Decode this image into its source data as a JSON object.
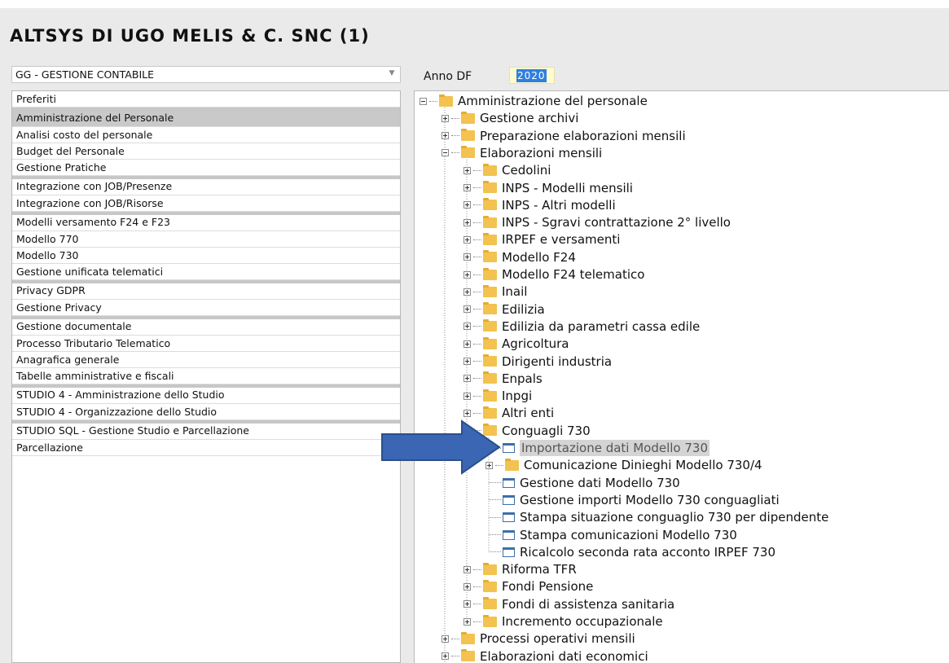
{
  "app_title": "ALTSYS DI UGO MELIS & C. SNC (1)",
  "module_select": {
    "value": "GG - GESTIONE CONTABILE",
    "arrow": "▼"
  },
  "anno": {
    "label": "Anno DF",
    "value": "2020"
  },
  "left_menu": [
    {
      "label": "Preferiti",
      "sep": false,
      "selected": false
    },
    {
      "label": "Amministrazione del Personale",
      "sep": true,
      "selected": true
    },
    {
      "label": "Analisi costo del personale",
      "sep": false,
      "selected": false
    },
    {
      "label": "Budget del Personale",
      "sep": false,
      "selected": false
    },
    {
      "label": "Gestione Pratiche",
      "sep": false,
      "selected": false
    },
    {
      "label": "Integrazione con JOB/Presenze",
      "sep": true,
      "selected": false
    },
    {
      "label": "Integrazione con JOB/Risorse",
      "sep": false,
      "selected": false
    },
    {
      "label": "Modelli versamento F24 e F23",
      "sep": true,
      "selected": false
    },
    {
      "label": "Modello 770",
      "sep": false,
      "selected": false
    },
    {
      "label": "Modello 730",
      "sep": false,
      "selected": false
    },
    {
      "label": "Gestione unificata telematici",
      "sep": false,
      "selected": false
    },
    {
      "label": "Privacy GDPR",
      "sep": true,
      "selected": false
    },
    {
      "label": "Gestione Privacy",
      "sep": false,
      "selected": false
    },
    {
      "label": "Gestione documentale",
      "sep": true,
      "selected": false
    },
    {
      "label": "Processo Tributario Telematico",
      "sep": false,
      "selected": false
    },
    {
      "label": "Anagrafica generale",
      "sep": false,
      "selected": false
    },
    {
      "label": "Tabelle amministrative e fiscali",
      "sep": false,
      "selected": false
    },
    {
      "label": "STUDIO 4 - Amministrazione dello Studio",
      "sep": true,
      "selected": false
    },
    {
      "label": "STUDIO 4 - Organizzazione dello Studio",
      "sep": false,
      "selected": false
    },
    {
      "label": "STUDIO SQL - Gestione Studio e Parcellazione",
      "sep": true,
      "selected": false
    },
    {
      "label": "Parcellazione",
      "sep": false,
      "selected": false
    }
  ],
  "tree": [
    {
      "label": "Amministrazione del personale",
      "depth": 0,
      "icon": "folder-icon",
      "expander": "minus"
    },
    {
      "label": "Gestione archivi",
      "depth": 1,
      "icon": "folder-icon",
      "expander": "plus"
    },
    {
      "label": "Preparazione elaborazioni mensili",
      "depth": 1,
      "icon": "folder-icon",
      "expander": "plus"
    },
    {
      "label": "Elaborazioni mensili",
      "depth": 1,
      "icon": "folder-icon",
      "expander": "minus"
    },
    {
      "label": "Cedolini",
      "depth": 2,
      "icon": "folder-icon",
      "expander": "plus"
    },
    {
      "label": "INPS - Modelli mensili",
      "depth": 2,
      "icon": "folder-icon",
      "expander": "plus"
    },
    {
      "label": "INPS - Altri modelli",
      "depth": 2,
      "icon": "folder-icon",
      "expander": "plus"
    },
    {
      "label": "INPS - Sgravi contrattazione 2° livello",
      "depth": 2,
      "icon": "folder-icon",
      "expander": "plus"
    },
    {
      "label": "IRPEF e versamenti",
      "depth": 2,
      "icon": "folder-icon",
      "expander": "plus"
    },
    {
      "label": "Modello F24",
      "depth": 2,
      "icon": "folder-icon",
      "expander": "plus"
    },
    {
      "label": "Modello F24 telematico",
      "depth": 2,
      "icon": "folder-icon",
      "expander": "plus"
    },
    {
      "label": "Inail",
      "depth": 2,
      "icon": "folder-icon",
      "expander": "plus"
    },
    {
      "label": "Edilizia",
      "depth": 2,
      "icon": "folder-icon",
      "expander": "plus"
    },
    {
      "label": "Edilizia da parametri cassa edile",
      "depth": 2,
      "icon": "folder-icon",
      "expander": "plus"
    },
    {
      "label": "Agricoltura",
      "depth": 2,
      "icon": "folder-icon",
      "expander": "plus"
    },
    {
      "label": "Dirigenti industria",
      "depth": 2,
      "icon": "folder-icon",
      "expander": "plus"
    },
    {
      "label": "Enpals",
      "depth": 2,
      "icon": "folder-icon",
      "expander": "plus"
    },
    {
      "label": "Inpgi",
      "depth": 2,
      "icon": "folder-icon",
      "expander": "plus"
    },
    {
      "label": "Altri enti",
      "depth": 2,
      "icon": "folder-icon",
      "expander": "plus"
    },
    {
      "label": "Conguagli 730",
      "depth": 2,
      "icon": "folder-icon",
      "expander": "minus"
    },
    {
      "label": "Importazione dati Modello 730",
      "depth": 3,
      "icon": "window-icon",
      "expander": "none",
      "highlighted": true
    },
    {
      "label": "Comunicazione Dinieghi Modello 730/4",
      "depth": 3,
      "icon": "folder-icon",
      "expander": "plus"
    },
    {
      "label": "Gestione dati Modello 730",
      "depth": 3,
      "icon": "window-icon",
      "expander": "none"
    },
    {
      "label": "Gestione importi Modello 730 conguagliati",
      "depth": 3,
      "icon": "window-icon",
      "expander": "none"
    },
    {
      "label": "Stampa situazione conguaglio 730 per dipendente",
      "depth": 3,
      "icon": "window-icon",
      "expander": "none"
    },
    {
      "label": "Stampa comunicazioni Modello 730",
      "depth": 3,
      "icon": "window-icon",
      "expander": "none"
    },
    {
      "label": "Ricalcolo seconda rata acconto IRPEF 730",
      "depth": 3,
      "icon": "window-icon",
      "expander": "none"
    },
    {
      "label": "Riforma TFR",
      "depth": 2,
      "icon": "folder-icon",
      "expander": "plus"
    },
    {
      "label": "Fondi Pensione",
      "depth": 2,
      "icon": "folder-icon",
      "expander": "plus"
    },
    {
      "label": "Fondi di assistenza sanitaria",
      "depth": 2,
      "icon": "folder-icon",
      "expander": "plus"
    },
    {
      "label": "Incremento occupazionale",
      "depth": 2,
      "icon": "folder-icon",
      "expander": "plus"
    },
    {
      "label": "Processi operativi mensili",
      "depth": 1,
      "icon": "folder-icon",
      "expander": "plus"
    },
    {
      "label": "Elaborazioni dati economici",
      "depth": 1,
      "icon": "folder-icon",
      "expander": "plus"
    }
  ],
  "colors": {
    "folder": "#f3c24f",
    "arrow": "#3a66b4",
    "selection": "#2f7fe0",
    "anno_bg": "#fffbd0"
  }
}
